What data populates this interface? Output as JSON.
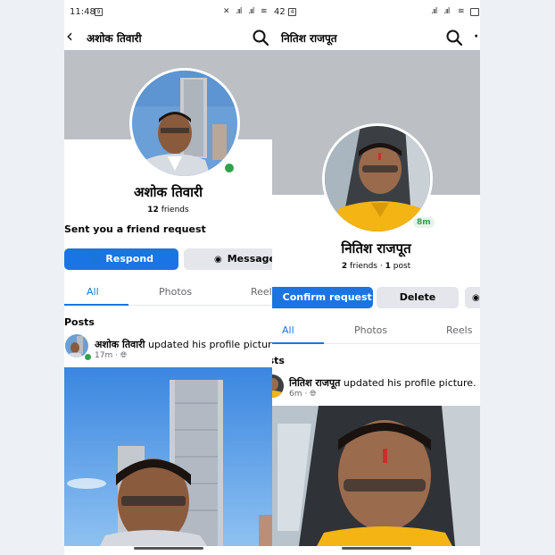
{
  "phone1": {
    "status": {
      "time": "11:48",
      "notif_badge": "9"
    },
    "header": {
      "title": "अशोक तिवारी"
    },
    "profile": {
      "name": "अशोक तिवारी",
      "friends_count": "12",
      "friends_label": "friends",
      "request_text": "Sent you a friend request",
      "online": true
    },
    "buttons": {
      "respond": "Respond",
      "message": "Message"
    },
    "tabs": [
      "All",
      "Photos",
      "Reels"
    ],
    "posts_label": "Posts",
    "post": {
      "author": "अशोक तिवारी",
      "action": "updated his profile picture.",
      "time": "17m",
      "separator": "·",
      "audience_icon": "globe-icon"
    }
  },
  "phone2": {
    "status": {
      "time": "42",
      "notif_badge": "4"
    },
    "header": {
      "title": "नितिश राजपूत"
    },
    "profile": {
      "name": "नितिश राजपूत",
      "friends_count": "2",
      "friends_label": "friends",
      "posts_count": "1",
      "posts_label": "post",
      "dot": "·",
      "active_badge": "8m"
    },
    "buttons": {
      "confirm": "Confirm request",
      "delete": "Delete"
    },
    "tabs": [
      "All",
      "Photos",
      "Reels"
    ],
    "posts_label": "Posts",
    "post": {
      "author": "नितिश राजपूत",
      "action": "updated his profile picture.",
      "time": "6m",
      "separator": "·",
      "audience_icon": "globe-icon"
    }
  },
  "colors": {
    "brand_blue": "#1b74e4",
    "button_gray": "#e4e6eb",
    "cover_gray": "#bcc0c4",
    "online_green": "#31a24c",
    "page_background": "#edf1f6"
  }
}
